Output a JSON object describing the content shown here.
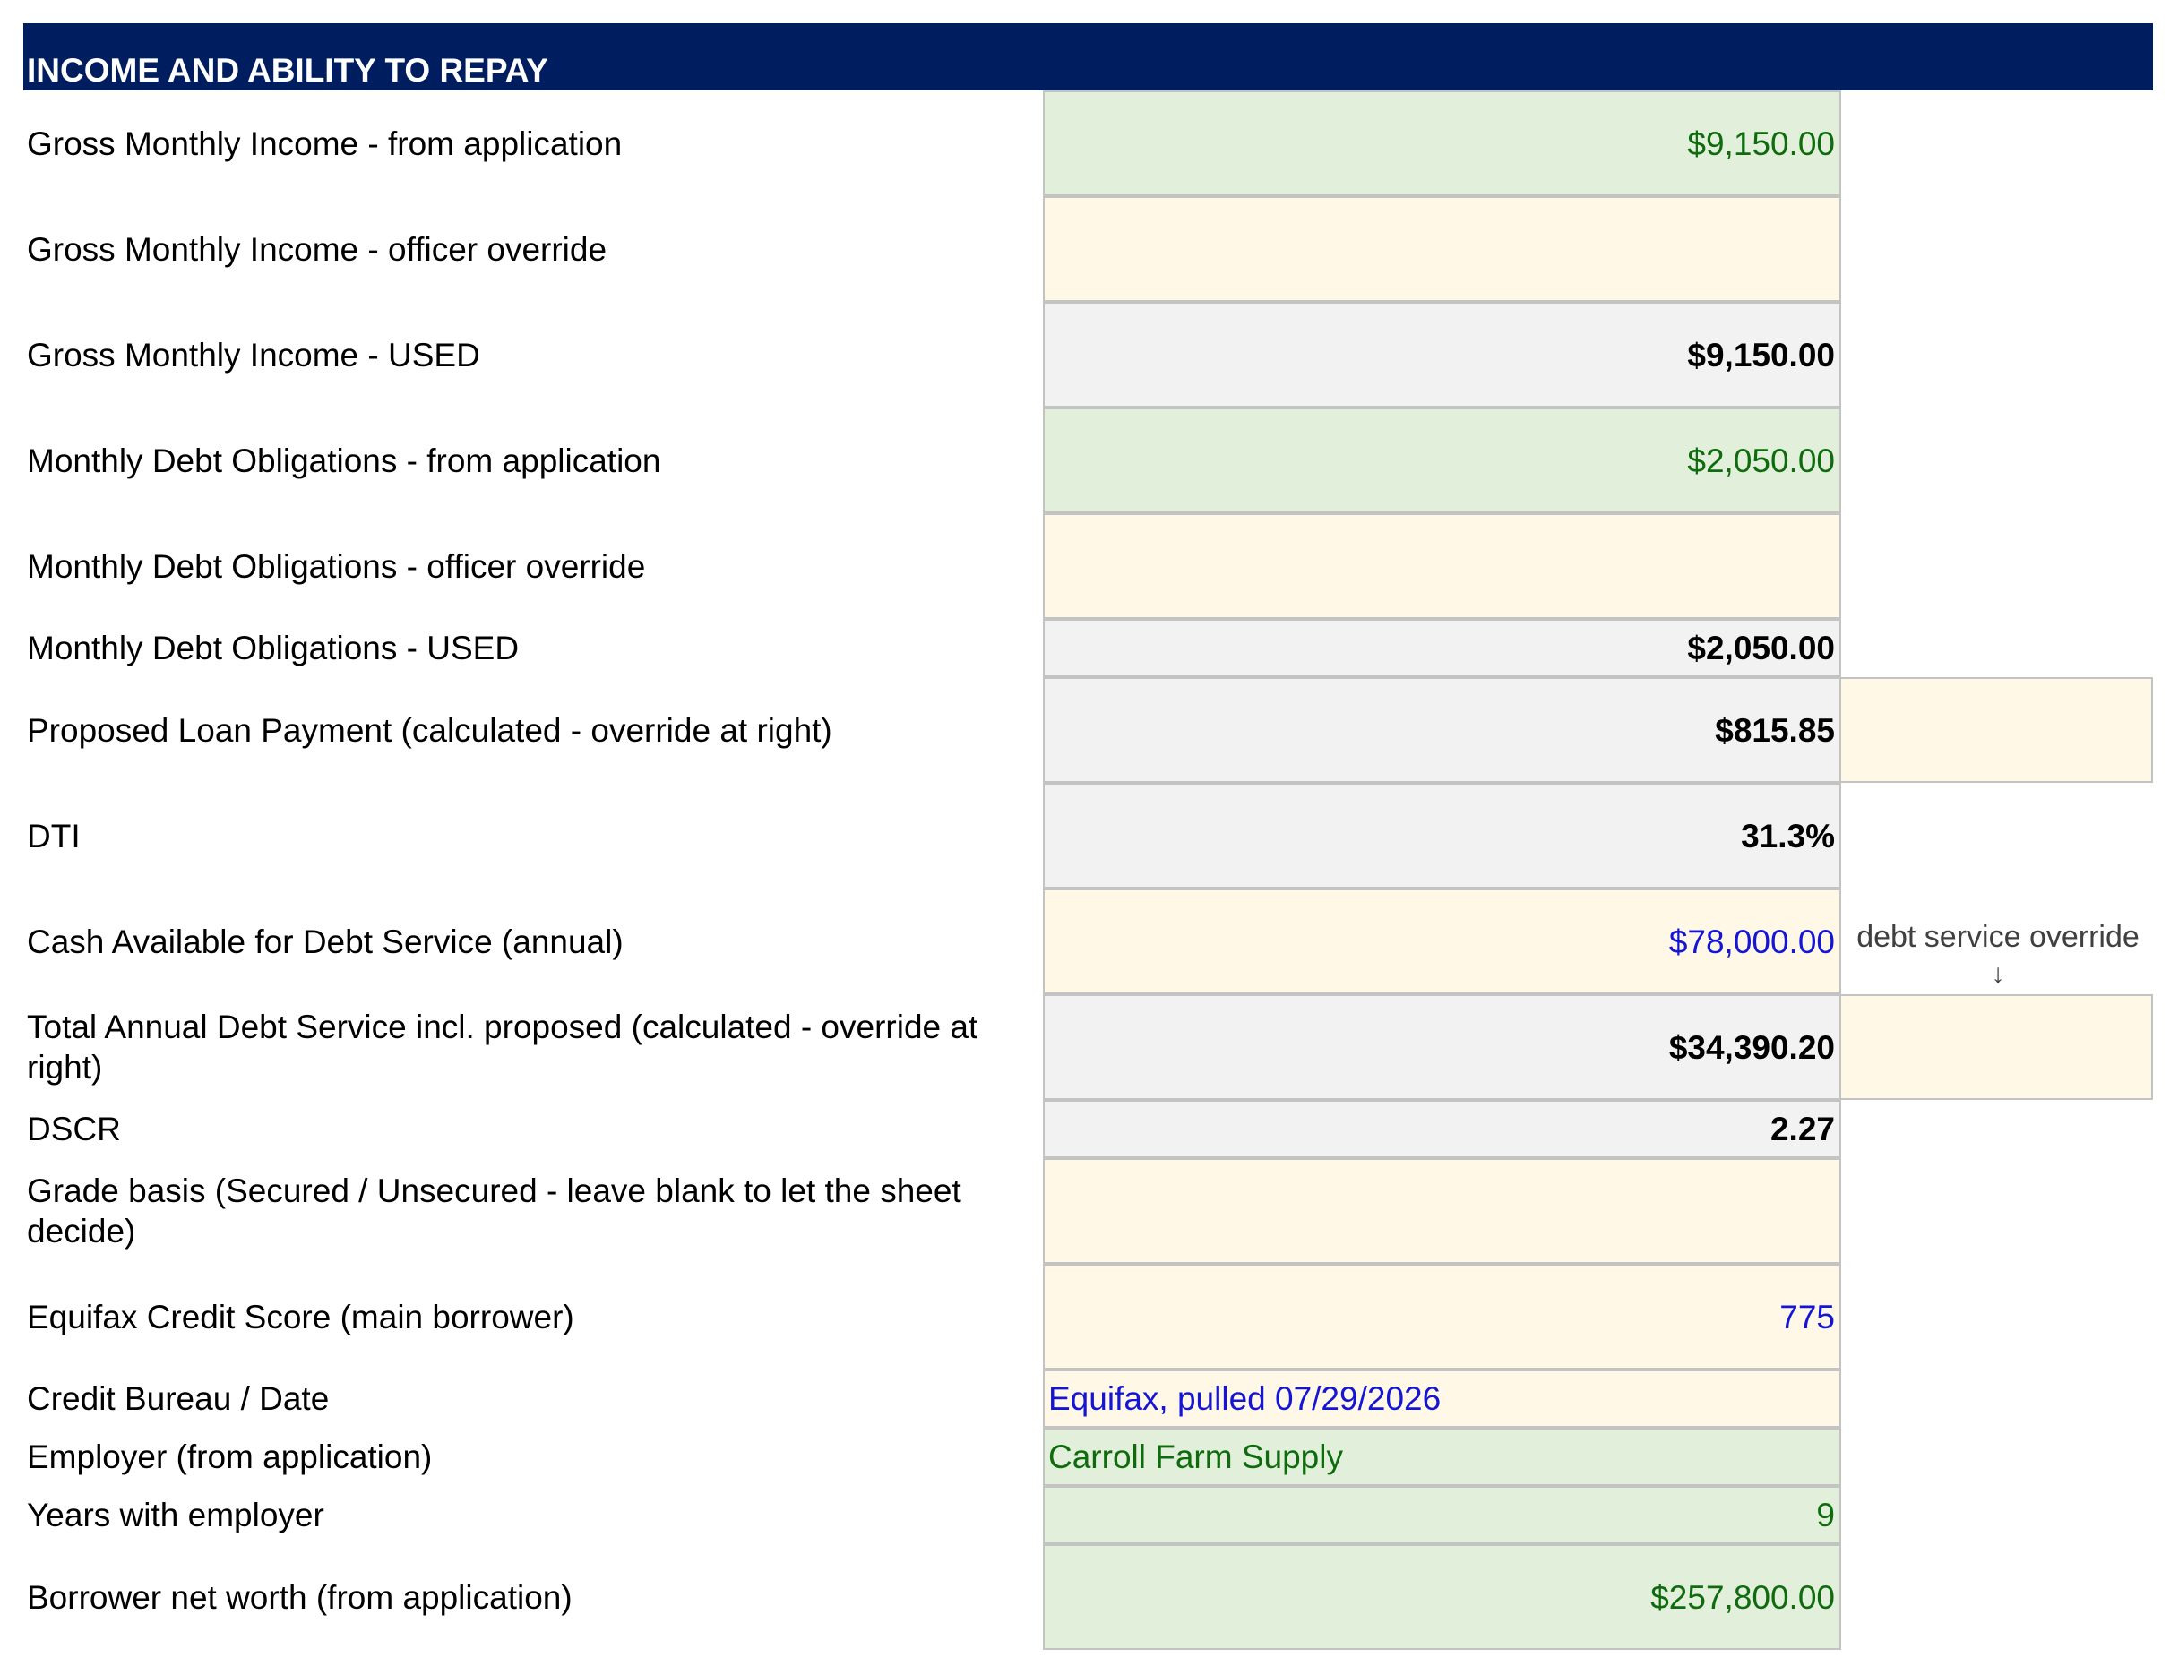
{
  "section": {
    "title": "INCOME AND ABILITY TO REPAY",
    "header_color": "#001e5f"
  },
  "colors": {
    "application_fill": "#e2efda",
    "application_text": "#0e6b0e",
    "input_fill": "#fff8e6",
    "input_text": "#1515d6",
    "calculated_fill": "#f2f2f2"
  },
  "rows": [
    {
      "label": "Gross Monthly Income - from application",
      "value": "$9,150.00"
    },
    {
      "label": "Gross Monthly Income - officer override",
      "value": ""
    },
    {
      "label": "Gross Monthly Income - USED",
      "value": "$9,150.00"
    },
    {
      "label": "Monthly Debt Obligations - from application",
      "value": "$2,050.00"
    },
    {
      "label": "Monthly Debt Obligations - officer override",
      "value": ""
    },
    {
      "label": "Monthly Debt Obligations - USED",
      "value": "$2,050.00"
    },
    {
      "label": "Proposed Loan Payment  (calculated - override at right)",
      "value": "$815.85",
      "override": ""
    },
    {
      "label": "DTI",
      "value": "31.3%"
    },
    {
      "label": "Cash Available for Debt Service (annual)",
      "value": "$78,000.00"
    },
    {
      "label": "Total Annual Debt Service incl. proposed  (calculated - override at right)",
      "value": "$34,390.20",
      "override": ""
    },
    {
      "label": "DSCR",
      "value": "2.27"
    },
    {
      "label": "Grade basis  (Secured / Unsecured - leave blank to let the sheet decide)",
      "value": ""
    },
    {
      "label": "Equifax Credit Score (main borrower)",
      "value": "775"
    },
    {
      "label": "Credit Bureau / Date",
      "value": "Equifax, pulled 07/29/2026"
    },
    {
      "label": "Employer (from application)",
      "value": "Carroll Farm Supply"
    },
    {
      "label": "Years with employer",
      "value": "9"
    },
    {
      "label": "Borrower net worth (from application)",
      "value": "$257,800.00"
    }
  ],
  "debt_service_override_note": "debt service override",
  "debt_service_override_arrow": "↓"
}
